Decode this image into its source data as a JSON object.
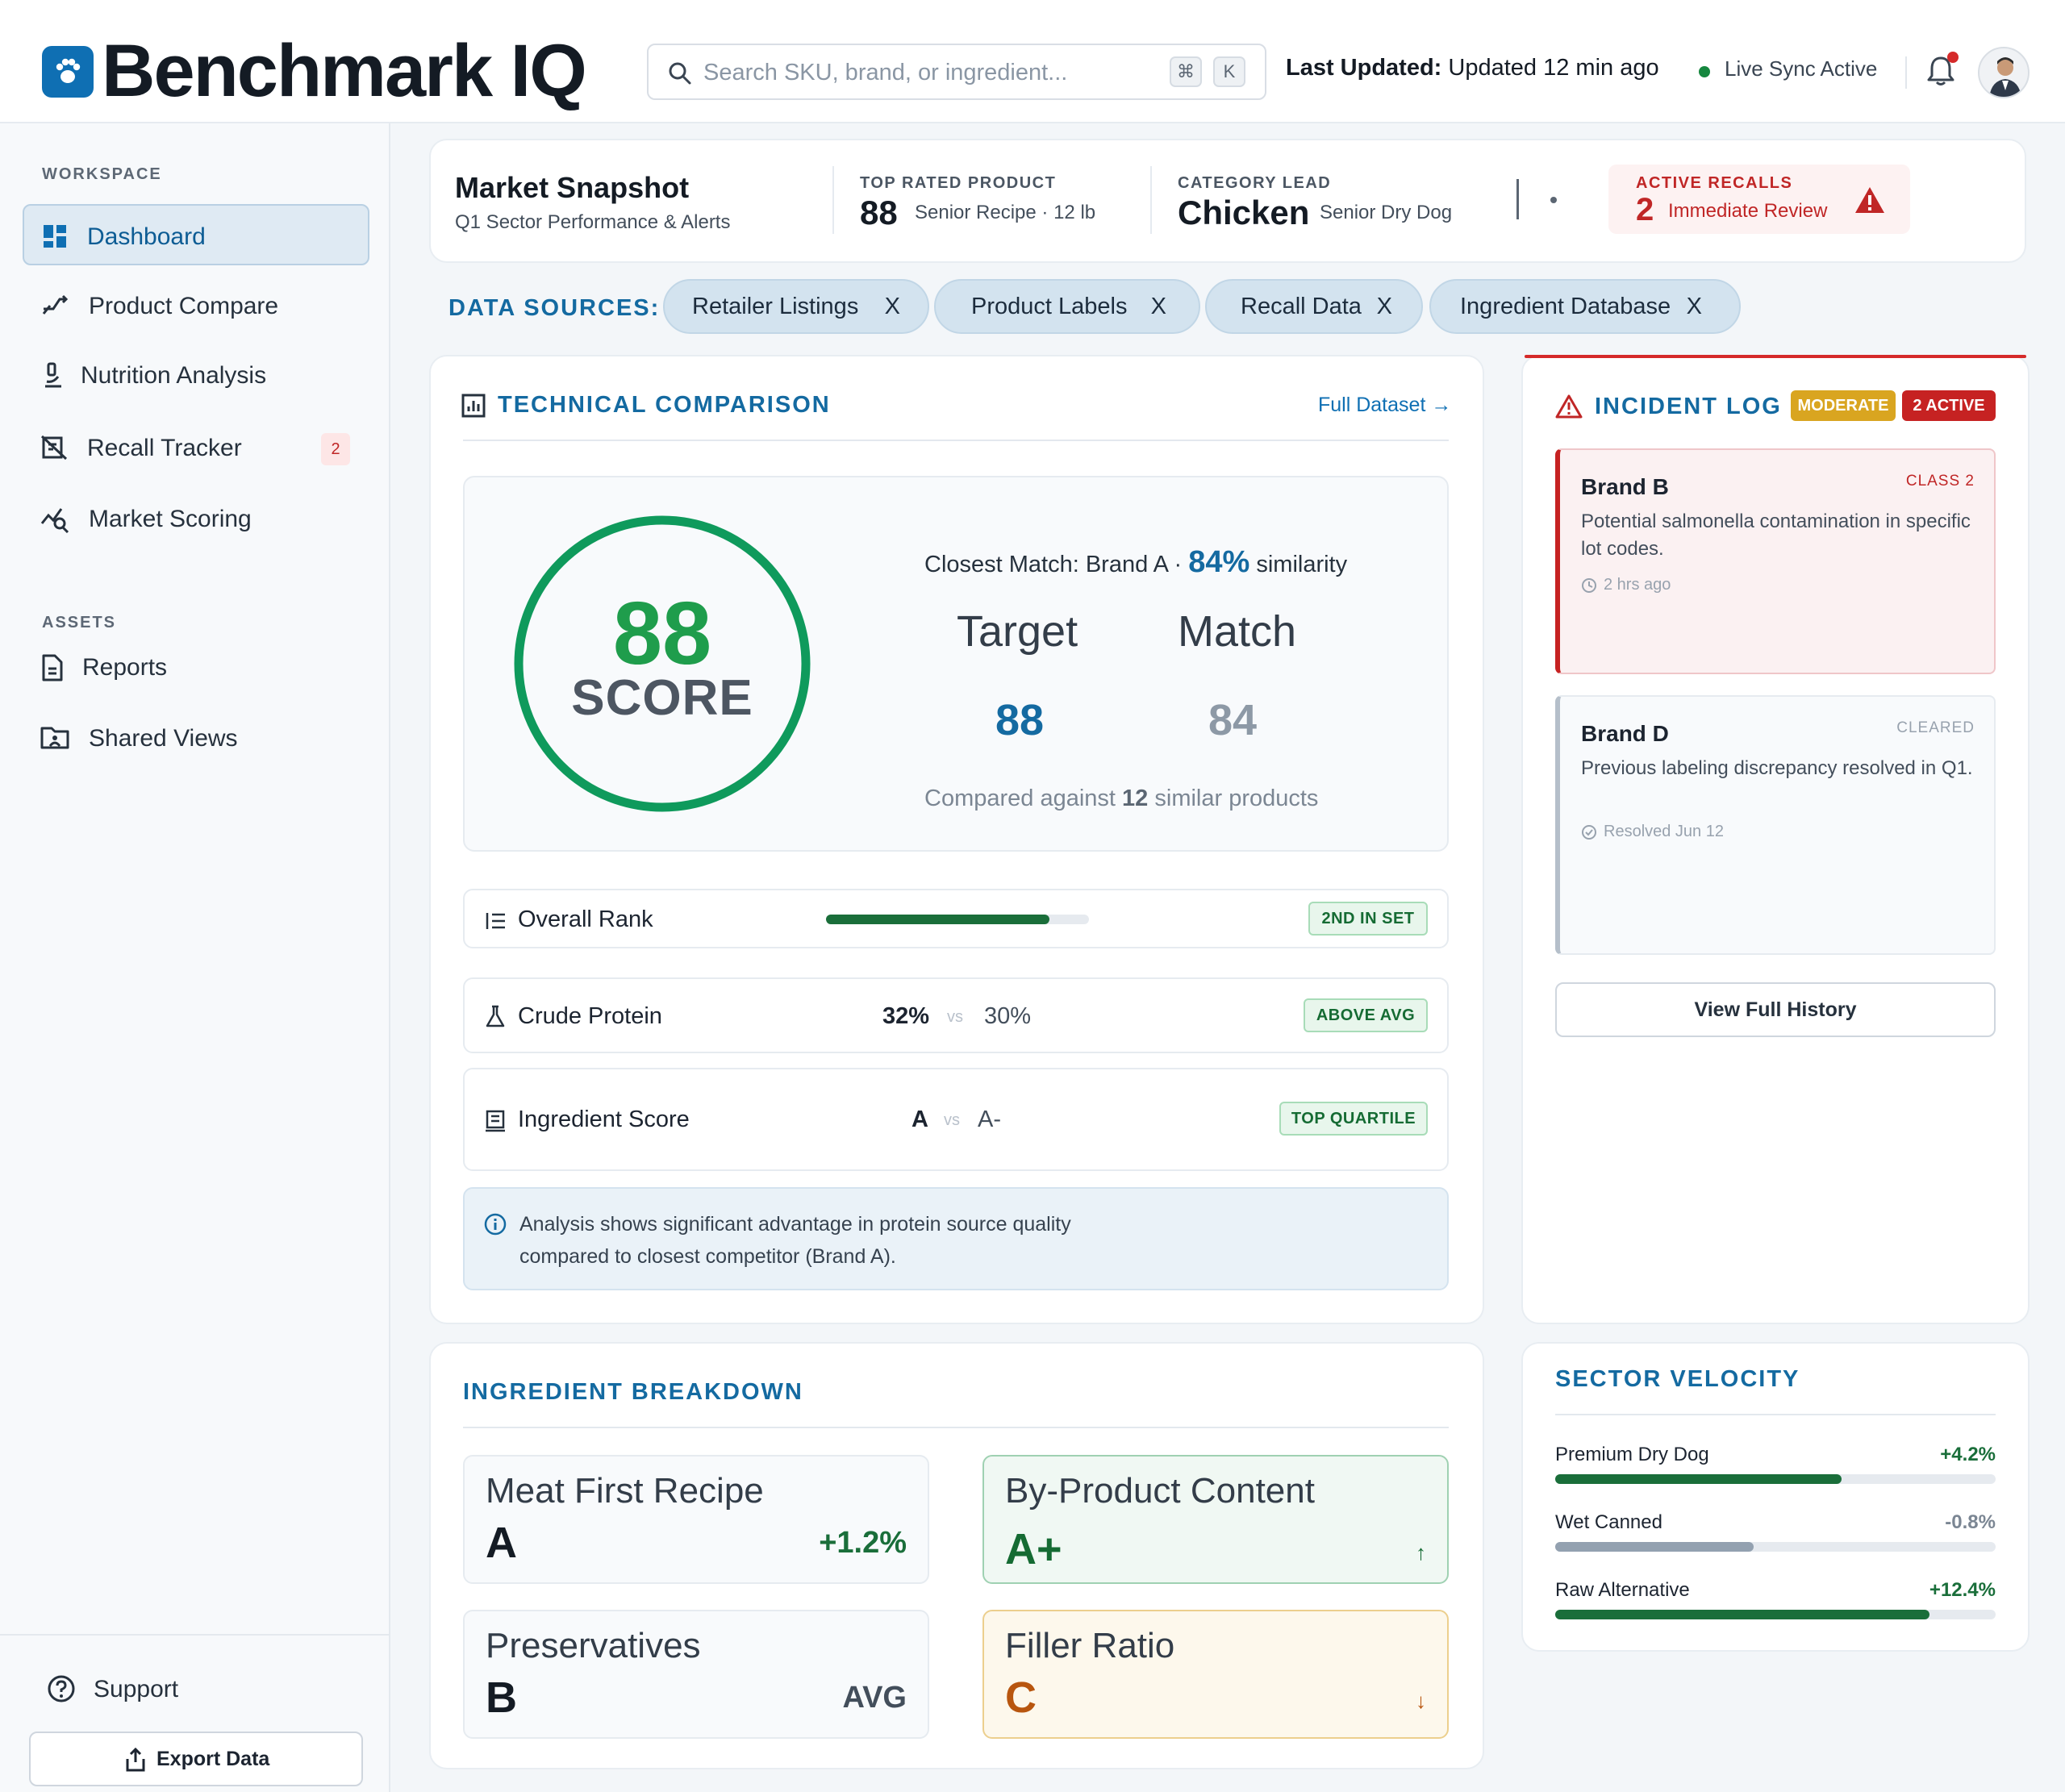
{
  "app": {
    "brand": "Benchmark IQ",
    "accent": "#0f6fb3"
  },
  "header": {
    "search_placeholder": "Search SKU, brand, or ingredient...",
    "kbd_cmd": "⌘",
    "kbd_k": "K",
    "last_updated_label": "Last Updated:",
    "last_updated_value": "Updated 12 min ago",
    "sync_status": "Live Sync Active"
  },
  "sidebar": {
    "workspace_label": "WORKSPACE",
    "items": [
      {
        "label": "Dashboard",
        "icon": "grid-icon"
      },
      {
        "label": "Product Compare",
        "icon": "compare-arrows-icon"
      },
      {
        "label": "Nutrition Analysis",
        "icon": "microscope-icon"
      },
      {
        "label": "Recall Tracker",
        "icon": "recall-icon",
        "badge": "2"
      },
      {
        "label": "Market Scoring",
        "icon": "chart-search-icon"
      }
    ],
    "assets_label": "ASSETS",
    "assets": [
      {
        "label": "Reports",
        "icon": "document-icon"
      },
      {
        "label": "Shared Views",
        "icon": "folder-share-icon"
      }
    ],
    "support_label": "Support",
    "export_label": "Export Data"
  },
  "snapshot": {
    "title": "Market Snapshot",
    "subtitle": "Q1 Sector Performance & Alerts",
    "top_rated_label": "TOP RATED PRODUCT",
    "top_rated_value": "88",
    "top_rated_desc": "Senior Recipe · 12 lb",
    "category_label": "CATEGORY LEAD",
    "category_value": "Chicken",
    "category_desc": "Senior Dry Dog",
    "recalls_label": "ACTIVE RECALLS",
    "recalls_value": "2",
    "recalls_desc": "Immediate Review"
  },
  "data_sources": {
    "label": "DATA SOURCES:",
    "chips": [
      "Retailer Listings",
      "Product Labels",
      "Recall Data",
      "Ingredient Database"
    ],
    "remove_glyph": "X"
  },
  "technical": {
    "title": "TECHNICAL COMPARISON",
    "link": "Full Dataset →",
    "score": "88",
    "score_label": "SCORE",
    "closest_prefix": "Closest Match: Brand A ·",
    "closest_pct": "84%",
    "closest_suffix": "similarity",
    "target_label": "Target",
    "match_label": "Match",
    "target_value": "88",
    "match_value": "84",
    "compared_prefix": "Compared against",
    "compared_count": "12",
    "compared_suffix": "similar products",
    "metrics": [
      {
        "name": "Overall Rank",
        "tag": "2ND IN SET",
        "progress": 0.85
      },
      {
        "name": "Crude Protein",
        "left": "32%",
        "vs": "vs",
        "right": "30%",
        "tag": "ABOVE AVG"
      },
      {
        "name": "Ingredient Score",
        "left": "A",
        "vs": "vs",
        "right": "A-",
        "tag": "TOP QUARTILE"
      }
    ],
    "note": "Analysis shows significant advantage in protein source quality compared to closest competitor (Brand A)."
  },
  "ingredients": {
    "title": "INGREDIENT BREAKDOWN",
    "cards": [
      {
        "name": "Meat First Recipe",
        "grade": "A",
        "right": "+1.2%"
      },
      {
        "name": "By-Product Content",
        "grade": "A+",
        "right": "↑"
      },
      {
        "name": "Preservatives",
        "grade": "B",
        "right": "AVG"
      },
      {
        "name": "Filler Ratio",
        "grade": "C",
        "right": "↓"
      }
    ]
  },
  "incidents": {
    "title": "INCIDENT LOG",
    "badge_moderate": "MODERATE",
    "badge_active": "2 ACTIVE",
    "items": [
      {
        "brand": "Brand B",
        "class": "CLASS  2",
        "desc": "Potential salmonella contamination in specific lot codes.",
        "meta": "2 hrs ago"
      },
      {
        "brand": "Brand D",
        "class": "CLEARED",
        "desc": "Previous labeling discrepancy resolved in Q1.",
        "meta": "Resolved Jun 12"
      }
    ],
    "history_button": "View Full History"
  },
  "velocity": {
    "title": "SECTOR VELOCITY",
    "rows": [
      {
        "name": "Premium Dry Dog",
        "value": "+4.2%",
        "fill": 0.65,
        "color": "#1a6e3a"
      },
      {
        "name": "Wet Canned",
        "value": "-0.8%",
        "fill": 0.45,
        "color": "#93a1b0"
      },
      {
        "name": "Raw Alternative",
        "value": "+12.4%",
        "fill": 0.85,
        "color": "#1a6e3a"
      }
    ]
  }
}
